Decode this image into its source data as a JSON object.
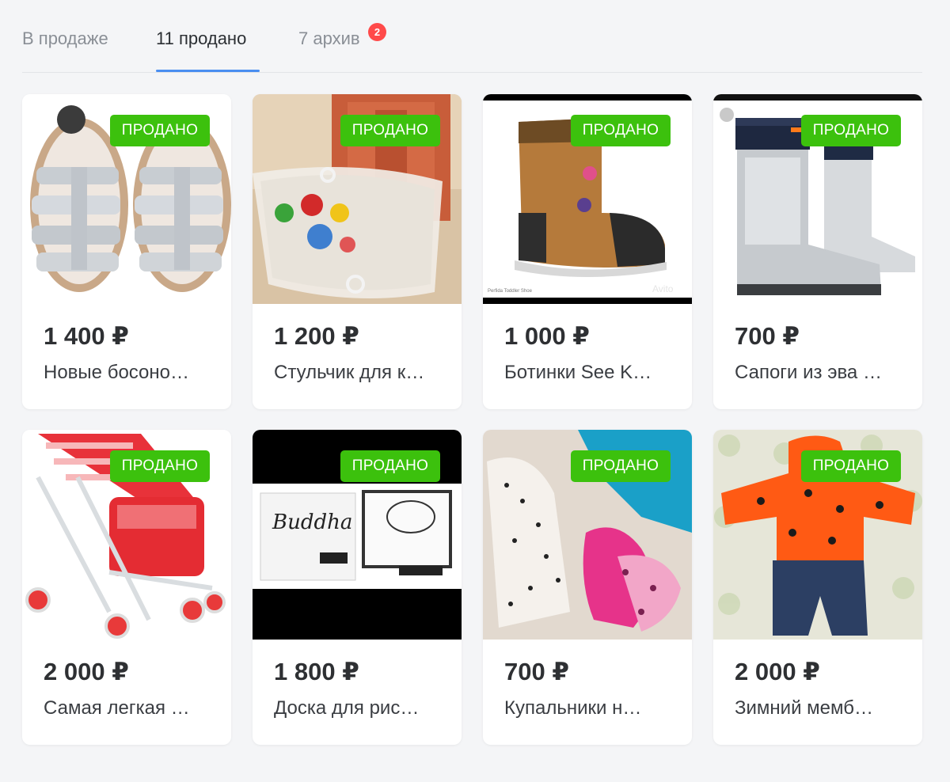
{
  "tabs": [
    {
      "label": "В продаже",
      "active": false
    },
    {
      "label": "11 продано",
      "active": true
    },
    {
      "label": "7 архив",
      "active": false,
      "badge": "2"
    }
  ],
  "sold_label": "ПРОДАНО",
  "colors": {
    "accent": "#4a8ef0",
    "sold": "#3cc10d",
    "badge": "#ff4a4a"
  },
  "items": [
    {
      "price": "1 400 ₽",
      "title": "Новые босоно…",
      "image": "silver-sandals"
    },
    {
      "price": "1 200 ₽",
      "title": "Стульчик для к…",
      "image": "high-chair-with-toys"
    },
    {
      "price": "1 000 ₽",
      "title": "Ботинки See K…",
      "image": "brown-toddler-boot"
    },
    {
      "price": "700 ₽",
      "title": "Сапоги из эва …",
      "image": "silver-rain-boots"
    },
    {
      "price": "2 000 ₽",
      "title": "Самая легкая …",
      "image": "red-stroller"
    },
    {
      "price": "1 800 ₽",
      "title": "Доска для рис…",
      "image": "buddha-board"
    },
    {
      "price": "700 ₽",
      "title": "Купальники н…",
      "image": "swimsuits"
    },
    {
      "price": "2 000 ₽",
      "title": "Зимний мемб…",
      "image": "winter-overall"
    }
  ],
  "image_text": {
    "buddha_board": "Buddha",
    "perfida": "Perfida Toddler Shoe",
    "watermark": "Avito"
  }
}
